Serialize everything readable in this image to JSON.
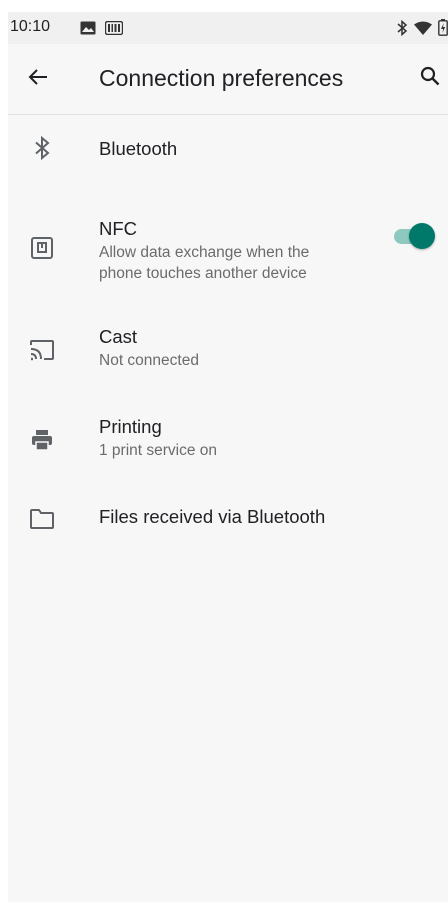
{
  "status_bar": {
    "time": "10:10",
    "icons": [
      "image-icon",
      "barcode-icon",
      "bluetooth-icon",
      "wifi-icon",
      "battery-icon"
    ]
  },
  "app_bar": {
    "title": "Connection preferences",
    "back_icon": "arrow-back-icon",
    "search_icon": "search-icon"
  },
  "items": [
    {
      "title": "Bluetooth",
      "subtitle": "",
      "icon": "bluetooth-icon"
    },
    {
      "title": "NFC",
      "subtitle": "Allow data exchange when the phone touches another device",
      "icon": "nfc-icon",
      "toggle_on": true
    },
    {
      "title": "Cast",
      "subtitle": "Not connected",
      "icon": "cast-icon"
    },
    {
      "title": "Printing",
      "subtitle": "1 print service on",
      "icon": "print-icon"
    },
    {
      "title": "Files received via Bluetooth",
      "subtitle": "",
      "icon": "folder-icon"
    }
  ],
  "colors": {
    "accent": "#00796b",
    "toggle_track": "#8ec9bf",
    "background": "#f7f7f7",
    "icon": "#5f6368"
  }
}
